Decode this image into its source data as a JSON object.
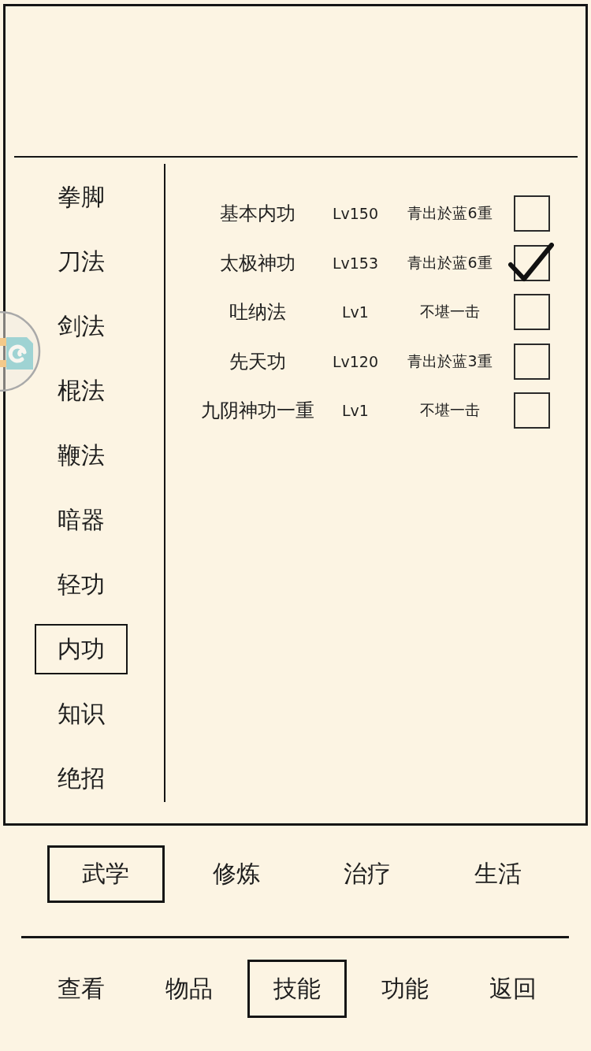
{
  "categories": [
    {
      "label": "拳脚",
      "selected": false
    },
    {
      "label": "刀法",
      "selected": false
    },
    {
      "label": "剑法",
      "selected": false
    },
    {
      "label": "棍法",
      "selected": false
    },
    {
      "label": "鞭法",
      "selected": false
    },
    {
      "label": "暗器",
      "selected": false
    },
    {
      "label": "轻功",
      "selected": false
    },
    {
      "label": "内功",
      "selected": true
    },
    {
      "label": "知识",
      "selected": false
    },
    {
      "label": "绝招",
      "selected": false
    }
  ],
  "skills": [
    {
      "name": "基本内功",
      "lv": "Lv150",
      "rank": "青出於蓝6重",
      "checked": false
    },
    {
      "name": "太极神功",
      "lv": "Lv153",
      "rank": "青出於蓝6重",
      "checked": true
    },
    {
      "name": "吐纳法",
      "lv": "Lv1",
      "rank": "不堪一击",
      "checked": false
    },
    {
      "name": "先天功",
      "lv": "Lv120",
      "rank": "青出於蓝3重",
      "checked": false
    },
    {
      "name": "九阴神功一重",
      "lv": "Lv1",
      "rank": "不堪一击",
      "checked": false
    }
  ],
  "sub_tabs": [
    {
      "label": "武学",
      "selected": true
    },
    {
      "label": "修炼",
      "selected": false
    },
    {
      "label": "治疗",
      "selected": false
    },
    {
      "label": "生活",
      "selected": false
    }
  ],
  "nav": [
    {
      "label": "查看",
      "selected": false
    },
    {
      "label": "物品",
      "selected": false
    },
    {
      "label": "技能",
      "selected": true
    },
    {
      "label": "功能",
      "selected": false
    },
    {
      "label": "返回",
      "selected": false
    }
  ]
}
